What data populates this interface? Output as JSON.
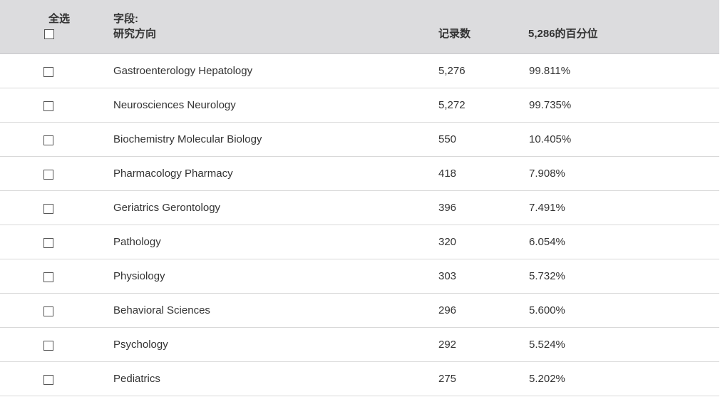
{
  "header": {
    "select_all": "全选",
    "field_label": "字段:",
    "field_name": "研究方向",
    "count": "记录数",
    "percent": "5,286的百分位"
  },
  "rows": [
    {
      "name": "Gastroenterology Hepatology",
      "count": "5,276",
      "percent": "99.811%"
    },
    {
      "name": "Neurosciences Neurology",
      "count": "5,272",
      "percent": "99.735%"
    },
    {
      "name": "Biochemistry Molecular Biology",
      "count": "550",
      "percent": "10.405%"
    },
    {
      "name": "Pharmacology Pharmacy",
      "count": "418",
      "percent": "7.908%"
    },
    {
      "name": "Geriatrics Gerontology",
      "count": "396",
      "percent": "7.491%"
    },
    {
      "name": "Pathology",
      "count": "320",
      "percent": "6.054%"
    },
    {
      "name": "Physiology",
      "count": "303",
      "percent": "5.732%"
    },
    {
      "name": "Behavioral Sciences",
      "count": "296",
      "percent": "5.600%"
    },
    {
      "name": "Psychology",
      "count": "292",
      "percent": "5.524%"
    },
    {
      "name": "Pediatrics",
      "count": "275",
      "percent": "5.202%"
    }
  ]
}
